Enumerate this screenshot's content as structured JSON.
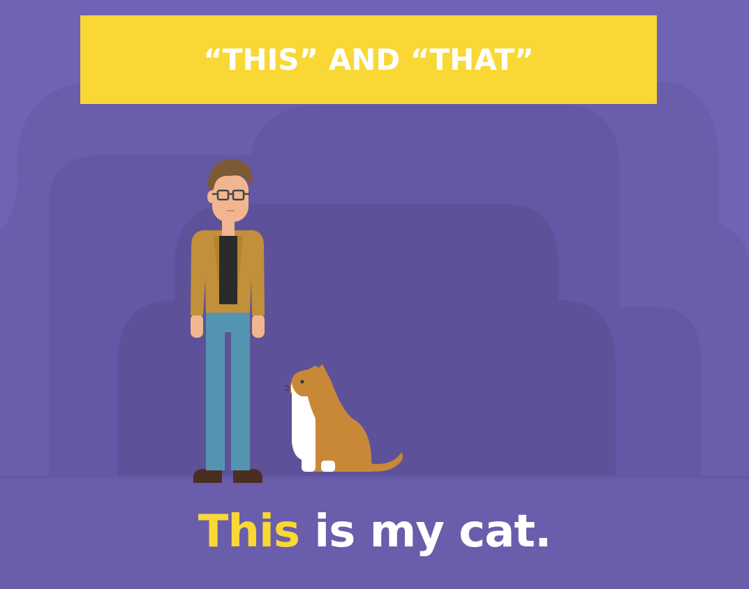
{
  "banner": {
    "title": "“THIS” AND “THAT”"
  },
  "caption": {
    "highlight": "This",
    "rest": " is my cat."
  },
  "illustration": {
    "person": "man-with-glasses",
    "animal": "cat-icon"
  },
  "colors": {
    "background": "#7063b5",
    "banner": "#f9d835",
    "highlight": "#f9d835",
    "caption": "#ffffff",
    "jacket": "#c28f3a",
    "jeans": "#5395b0",
    "cat": "#c98838"
  }
}
